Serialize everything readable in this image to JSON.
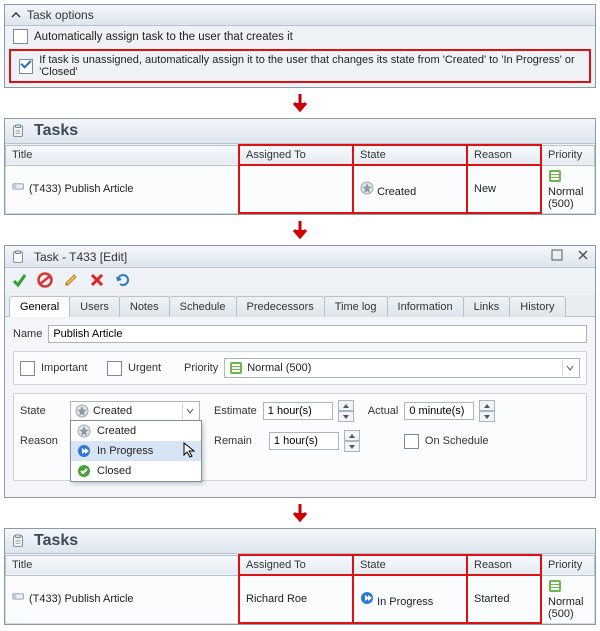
{
  "options": {
    "panel_title": "Task options",
    "opt1_label": "Automatically assign task to the user that creates it",
    "opt2_label": "If task is unassigned, automatically assign it to the user that changes its state from  'Created' to 'In Progress' or 'Closed'",
    "opt1_checked": false,
    "opt2_checked": true
  },
  "table": {
    "header_title": "Tasks",
    "cols": {
      "title": "Title",
      "assigned": "Assigned To",
      "state": "State",
      "reason": "Reason",
      "priority": "Priority"
    }
  },
  "task_before": {
    "title": "(T433) Publish Article",
    "assigned": "",
    "state": "Created",
    "reason": "New",
    "priority": "Normal (500)"
  },
  "task_after": {
    "title": "(T433) Publish Article",
    "assigned": "Richard Roe",
    "state": "In Progress",
    "reason": "Started",
    "priority": "Normal (500)"
  },
  "editor": {
    "window_title": "Task - T433 [Edit]",
    "tabs": [
      "General",
      "Users",
      "Notes",
      "Schedule",
      "Predecessors",
      "Time log",
      "Information",
      "Links",
      "History"
    ],
    "name_label": "Name",
    "name_value": "Publish Article",
    "important_label": "Important",
    "urgent_label": "Urgent",
    "priority_label": "Priority",
    "priority_value": "Normal (500)",
    "state_label": "State",
    "state_value": "Created",
    "reason_label": "Reason",
    "estimate_label": "Estimate",
    "estimate_value": "1 hour(s)",
    "actual_label": "Actual",
    "actual_value": "0 minute(s)",
    "remain_label": "Remain",
    "remain_value": "1 hour(s)",
    "onschedule_label": "On Schedule",
    "state_options": [
      "Created",
      "In Progress",
      "Closed"
    ]
  },
  "colors": {
    "highlight": "#d11",
    "accent_green": "#4caf50"
  }
}
